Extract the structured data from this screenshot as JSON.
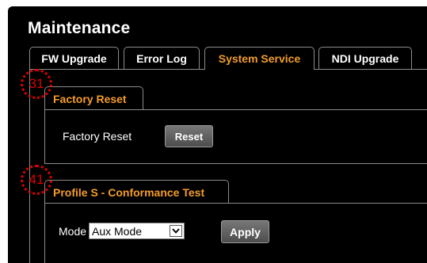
{
  "page": {
    "title": "Maintenance"
  },
  "tabs": [
    {
      "label": "FW Upgrade",
      "active": false
    },
    {
      "label": "Error Log",
      "active": false
    },
    {
      "label": "System Service",
      "active": true
    },
    {
      "label": "NDI Upgrade",
      "active": false
    }
  ],
  "factory_reset": {
    "section_title": "Factory Reset",
    "label": "Factory Reset",
    "button_label": "Reset",
    "marker": "31"
  },
  "conformance": {
    "section_title": "Profile S - Conformance Test",
    "mode_label": "Mode",
    "mode_value": "Aux Mode",
    "button_label": "Apply",
    "marker": "41"
  },
  "colors": {
    "background": "#000000",
    "active_text": "#f39c2b",
    "border": "#8c8c8c",
    "marker": "#e00000"
  },
  "icons": {
    "select_arrow": "chevron-down-icon"
  }
}
